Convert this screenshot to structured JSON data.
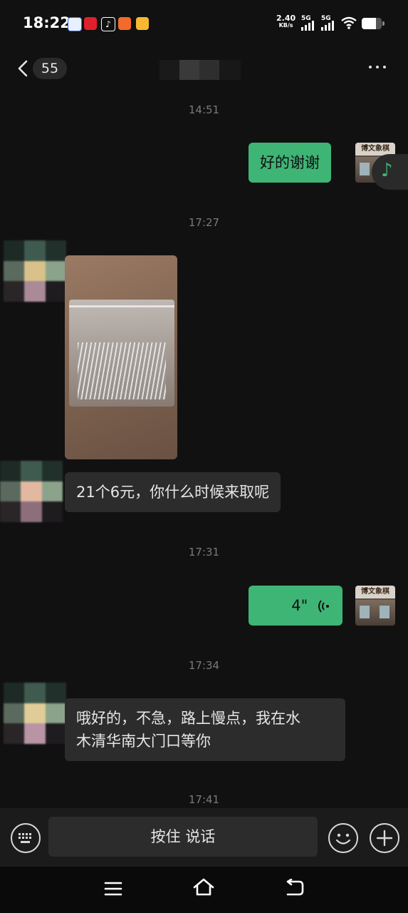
{
  "status_bar": {
    "time": "18:22",
    "net_speed_value": "2.40",
    "net_speed_unit": "KB/s",
    "sim1": "5G",
    "sim2": "5G"
  },
  "header": {
    "unread_count": "55"
  },
  "messages": {
    "ts1": "14:51",
    "m1_text": "好的谢谢",
    "ts2": "17:27",
    "m3_text": "21个6元，你什么时候来取呢",
    "ts3": "17:31",
    "voice_duration": "4\"",
    "ts4": "17:34",
    "m5_line1": "哦好的，不急，路上慢点，我在水",
    "m5_line2": "木清华南大门口等你",
    "ts5": "17:41"
  },
  "my_avatar_sign": "博文象棋",
  "input_bar": {
    "hold_to_talk": "按住 说话"
  },
  "colors": {
    "outgoing_bubble": "#3eb575",
    "incoming_bubble": "#2c2c2c",
    "background": "#111111"
  },
  "icons": [
    "keyboard-icon",
    "emoji-icon",
    "plus-icon",
    "back-chevron-icon",
    "more-icon",
    "music-note-icon",
    "voice-wave-icon",
    "menu-icon",
    "home-icon",
    "return-icon"
  ]
}
